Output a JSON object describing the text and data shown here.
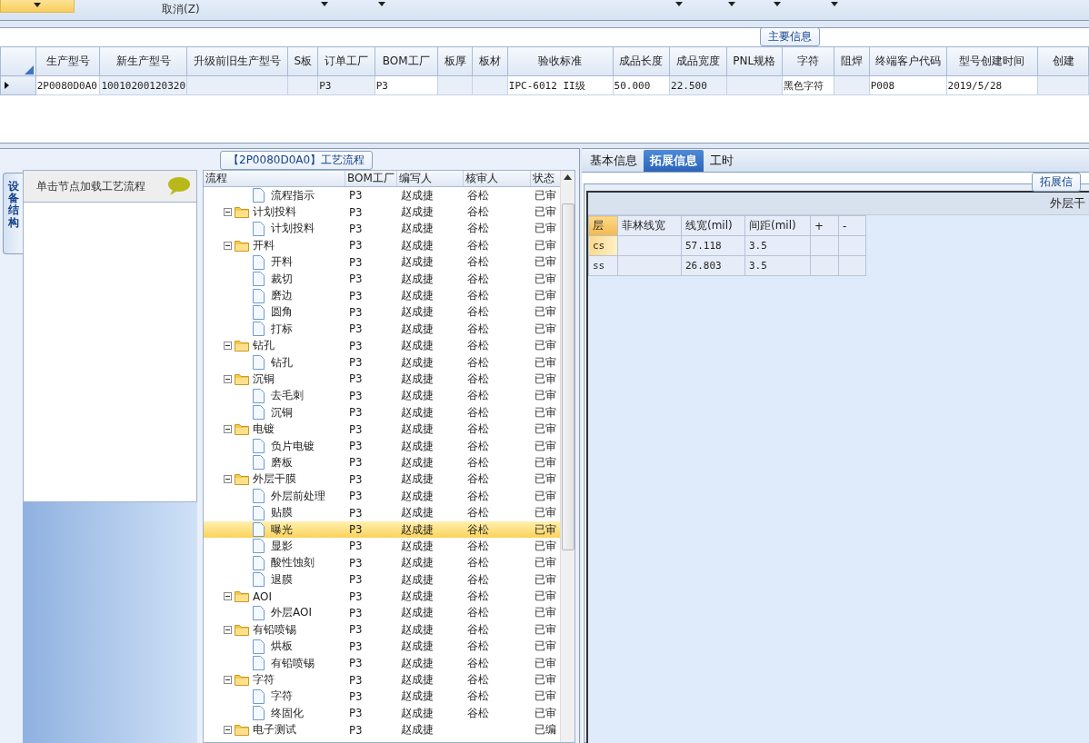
{
  "toolbar": {
    "buttons": [
      {
        "label": "取消(Z)"
      }
    ]
  },
  "main_info": {
    "title": "主要信息",
    "columns": [
      "生产型号",
      "新生产型号",
      "升级前旧生产型号",
      "S板",
      "订单工厂",
      "BOM工厂",
      "板厚",
      "板材",
      "验收标准",
      "成品长度",
      "成品宽度",
      "PNL规格",
      "字符",
      "阻焊",
      "终端客户代码",
      "型号创建时间",
      "创建"
    ],
    "rows": [
      {
        "selected": true,
        "cells": [
          "2P0080D0A0",
          "10010200120320",
          "",
          "",
          "P3",
          "P3",
          "",
          "",
          "IPC-6012 II级",
          "50.000",
          "22.500",
          "",
          "黑色字符",
          "",
          "P008",
          "2019/5/28",
          ""
        ]
      }
    ]
  },
  "process": {
    "title": "【2P0080D0A0】工艺流程",
    "side_tab": {
      "label": "设备结构",
      "selected": true
    },
    "node_list": {
      "hint": "单击节点加载工艺流程"
    },
    "columns": [
      "流程",
      "BOM工厂",
      "编写人",
      "核审人",
      "状态"
    ],
    "rows": [
      {
        "kind": "leaf",
        "name": "流程指示",
        "bom": "P3",
        "writer": "赵成捷",
        "reviewer": "谷松",
        "status": "已审",
        "selected": false
      },
      {
        "kind": "folder",
        "name": "计划投料",
        "bom": "P3",
        "writer": "赵成捷",
        "reviewer": "谷松",
        "status": "已审",
        "selected": false,
        "expanded": true,
        "children": [
          {
            "kind": "leaf",
            "name": "计划投料",
            "bom": "P3",
            "writer": "赵成捷",
            "reviewer": "谷松",
            "status": "已审",
            "selected": false
          }
        ]
      },
      {
        "kind": "folder",
        "name": "开料",
        "bom": "P3",
        "writer": "赵成捷",
        "reviewer": "谷松",
        "status": "已审",
        "selected": false,
        "expanded": true,
        "children": [
          {
            "kind": "leaf",
            "name": "开料",
            "bom": "P3",
            "writer": "赵成捷",
            "reviewer": "谷松",
            "status": "已审",
            "selected": false
          },
          {
            "kind": "leaf",
            "name": "裁切",
            "bom": "P3",
            "writer": "赵成捷",
            "reviewer": "谷松",
            "status": "已审",
            "selected": false
          },
          {
            "kind": "leaf",
            "name": "磨边",
            "bom": "P3",
            "writer": "赵成捷",
            "reviewer": "谷松",
            "status": "已审",
            "selected": false
          },
          {
            "kind": "leaf",
            "name": "圆角",
            "bom": "P3",
            "writer": "赵成捷",
            "reviewer": "谷松",
            "status": "已审",
            "selected": false
          },
          {
            "kind": "leaf",
            "name": "打标",
            "bom": "P3",
            "writer": "赵成捷",
            "reviewer": "谷松",
            "status": "已审",
            "selected": false
          }
        ]
      },
      {
        "kind": "folder",
        "name": "钻孔",
        "bom": "P3",
        "writer": "赵成捷",
        "reviewer": "谷松",
        "status": "已审",
        "selected": false,
        "expanded": true,
        "children": [
          {
            "kind": "leaf",
            "name": "钻孔",
            "bom": "P3",
            "writer": "赵成捷",
            "reviewer": "谷松",
            "status": "已审",
            "selected": false
          }
        ]
      },
      {
        "kind": "folder",
        "name": "沉铜",
        "bom": "P3",
        "writer": "赵成捷",
        "reviewer": "谷松",
        "status": "已审",
        "selected": false,
        "expanded": true,
        "children": [
          {
            "kind": "leaf",
            "name": "去毛刺",
            "bom": "P3",
            "writer": "赵成捷",
            "reviewer": "谷松",
            "status": "已审",
            "selected": false
          },
          {
            "kind": "leaf",
            "name": "沉铜",
            "bom": "P3",
            "writer": "赵成捷",
            "reviewer": "谷松",
            "status": "已审",
            "selected": false
          }
        ]
      },
      {
        "kind": "folder",
        "name": "电镀",
        "bom": "P3",
        "writer": "赵成捷",
        "reviewer": "谷松",
        "status": "已审",
        "selected": false,
        "expanded": true,
        "children": [
          {
            "kind": "leaf",
            "name": "负片电镀",
            "bom": "P3",
            "writer": "赵成捷",
            "reviewer": "谷松",
            "status": "已审",
            "selected": false
          },
          {
            "kind": "leaf",
            "name": "磨板",
            "bom": "P3",
            "writer": "赵成捷",
            "reviewer": "谷松",
            "status": "已审",
            "selected": false
          }
        ]
      },
      {
        "kind": "folder",
        "name": "外层干膜",
        "bom": "P3",
        "writer": "赵成捷",
        "reviewer": "谷松",
        "status": "已审",
        "selected": false,
        "expanded": true,
        "children": [
          {
            "kind": "leaf",
            "name": "外层前处理",
            "bom": "P3",
            "writer": "赵成捷",
            "reviewer": "谷松",
            "status": "已审",
            "selected": false
          },
          {
            "kind": "leaf",
            "name": "贴膜",
            "bom": "P3",
            "writer": "赵成捷",
            "reviewer": "谷松",
            "status": "已审",
            "selected": false
          },
          {
            "kind": "leaf",
            "name": "曝光",
            "bom": "P3",
            "writer": "赵成捷",
            "reviewer": "谷松",
            "status": "已审",
            "selected": true
          },
          {
            "kind": "leaf",
            "name": "显影",
            "bom": "P3",
            "writer": "赵成捷",
            "reviewer": "谷松",
            "status": "已审",
            "selected": false
          },
          {
            "kind": "leaf",
            "name": "酸性蚀刻",
            "bom": "P3",
            "writer": "赵成捷",
            "reviewer": "谷松",
            "status": "已审",
            "selected": false
          },
          {
            "kind": "leaf",
            "name": "退膜",
            "bom": "P3",
            "writer": "赵成捷",
            "reviewer": "谷松",
            "status": "已审",
            "selected": false
          }
        ]
      },
      {
        "kind": "folder",
        "name": "AOI",
        "bom": "P3",
        "writer": "赵成捷",
        "reviewer": "谷松",
        "status": "已审",
        "selected": false,
        "expanded": true,
        "children": [
          {
            "kind": "leaf",
            "name": "外层AOI",
            "bom": "P3",
            "writer": "赵成捷",
            "reviewer": "谷松",
            "status": "已审",
            "selected": false
          }
        ]
      },
      {
        "kind": "folder",
        "name": "有铅喷锡",
        "bom": "P3",
        "writer": "赵成捷",
        "reviewer": "谷松",
        "status": "已审",
        "selected": false,
        "expanded": true,
        "children": [
          {
            "kind": "leaf",
            "name": "烘板",
            "bom": "P3",
            "writer": "赵成捷",
            "reviewer": "谷松",
            "status": "已审",
            "selected": false
          },
          {
            "kind": "leaf",
            "name": "有铅喷锡",
            "bom": "P3",
            "writer": "赵成捷",
            "reviewer": "谷松",
            "status": "已审",
            "selected": false
          }
        ]
      },
      {
        "kind": "folder",
        "name": "字符",
        "bom": "P3",
        "writer": "赵成捷",
        "reviewer": "谷松",
        "status": "已审",
        "selected": false,
        "expanded": true,
        "children": [
          {
            "kind": "leaf",
            "name": "字符",
            "bom": "P3",
            "writer": "赵成捷",
            "reviewer": "谷松",
            "status": "已审",
            "selected": false
          },
          {
            "kind": "leaf",
            "name": "终固化",
            "bom": "P3",
            "writer": "赵成捷",
            "reviewer": "谷松",
            "status": "已审",
            "selected": false
          }
        ]
      },
      {
        "kind": "folder",
        "name": "电子测试",
        "bom": "P3",
        "writer": "赵成捷",
        "status": "已编",
        "selected": false,
        "expanded": true
      }
    ]
  },
  "details": {
    "tabs": [
      {
        "label": "基本信息",
        "selected": false
      },
      {
        "label": "拓展信息",
        "selected": true
      },
      {
        "label": "工时",
        "selected": false
      }
    ],
    "group_title": "拓展信",
    "section_title": "外层干",
    "columns": [
      "层",
      "菲林线宽",
      "线宽(mil)",
      "间距(mil)",
      "+",
      "-"
    ],
    "rows": [
      {
        "selected": true,
        "cells": [
          "cs",
          "",
          "57.118",
          "3.5",
          "",
          ""
        ]
      },
      {
        "selected": false,
        "cells": [
          "ss",
          "",
          "26.803",
          "3.5",
          "",
          ""
        ]
      }
    ]
  }
}
